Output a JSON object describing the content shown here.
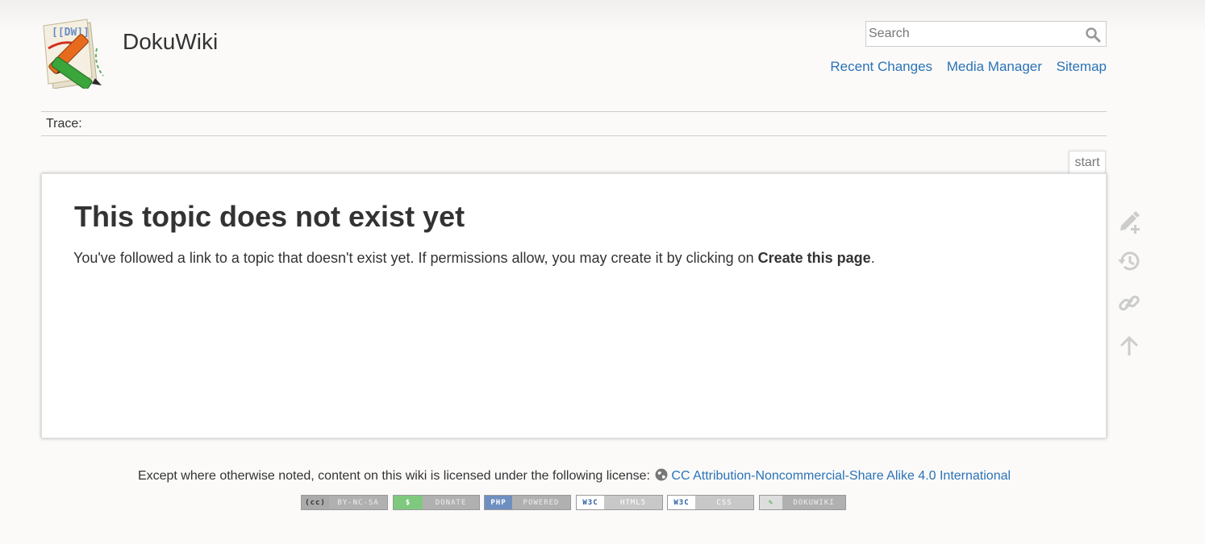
{
  "site": {
    "title": "DokuWiki",
    "logo_text": "[[DW]]"
  },
  "search": {
    "placeholder": "Search",
    "value": ""
  },
  "usertools": [
    {
      "label": "Recent Changes"
    },
    {
      "label": "Media Manager"
    },
    {
      "label": "Sitemap"
    }
  ],
  "breadcrumbs": {
    "label": "Trace:"
  },
  "page_id": "start",
  "content": {
    "heading": "This topic does not exist yet",
    "body_prefix": "You've followed a link to a topic that doesn't exist yet. If permissions allow, you may create it by clicking on ",
    "body_bold": "Create this page",
    "body_suffix": "."
  },
  "pagetools": [
    {
      "icon": "pencil-plus-icon",
      "action": "create"
    },
    {
      "icon": "history-icon",
      "action": "revisions"
    },
    {
      "icon": "link-icon",
      "action": "backlinks"
    },
    {
      "icon": "arrow-up-icon",
      "action": "back-to-top"
    }
  ],
  "footer": {
    "license_prefix": "Except where otherwise noted, content on this wiki is licensed under the following license:",
    "license_link": "CC Attribution-Noncommercial-Share Alike 4.0 International",
    "badges": [
      {
        "left": "(cc)",
        "right": "BY-NC-SA"
      },
      {
        "left": "$",
        "right": "DONATE"
      },
      {
        "left": "PHP",
        "right": "POWERED"
      },
      {
        "left": "W3C",
        "right": "HTML5"
      },
      {
        "left": "W3C",
        "right": "CSS"
      },
      {
        "left": "✎",
        "right": "DOKUWIKI"
      }
    ]
  },
  "colors": {
    "link": "#2b73b7",
    "text": "#333333",
    "background": "#fbfaf9",
    "icon": "#cccccc"
  }
}
